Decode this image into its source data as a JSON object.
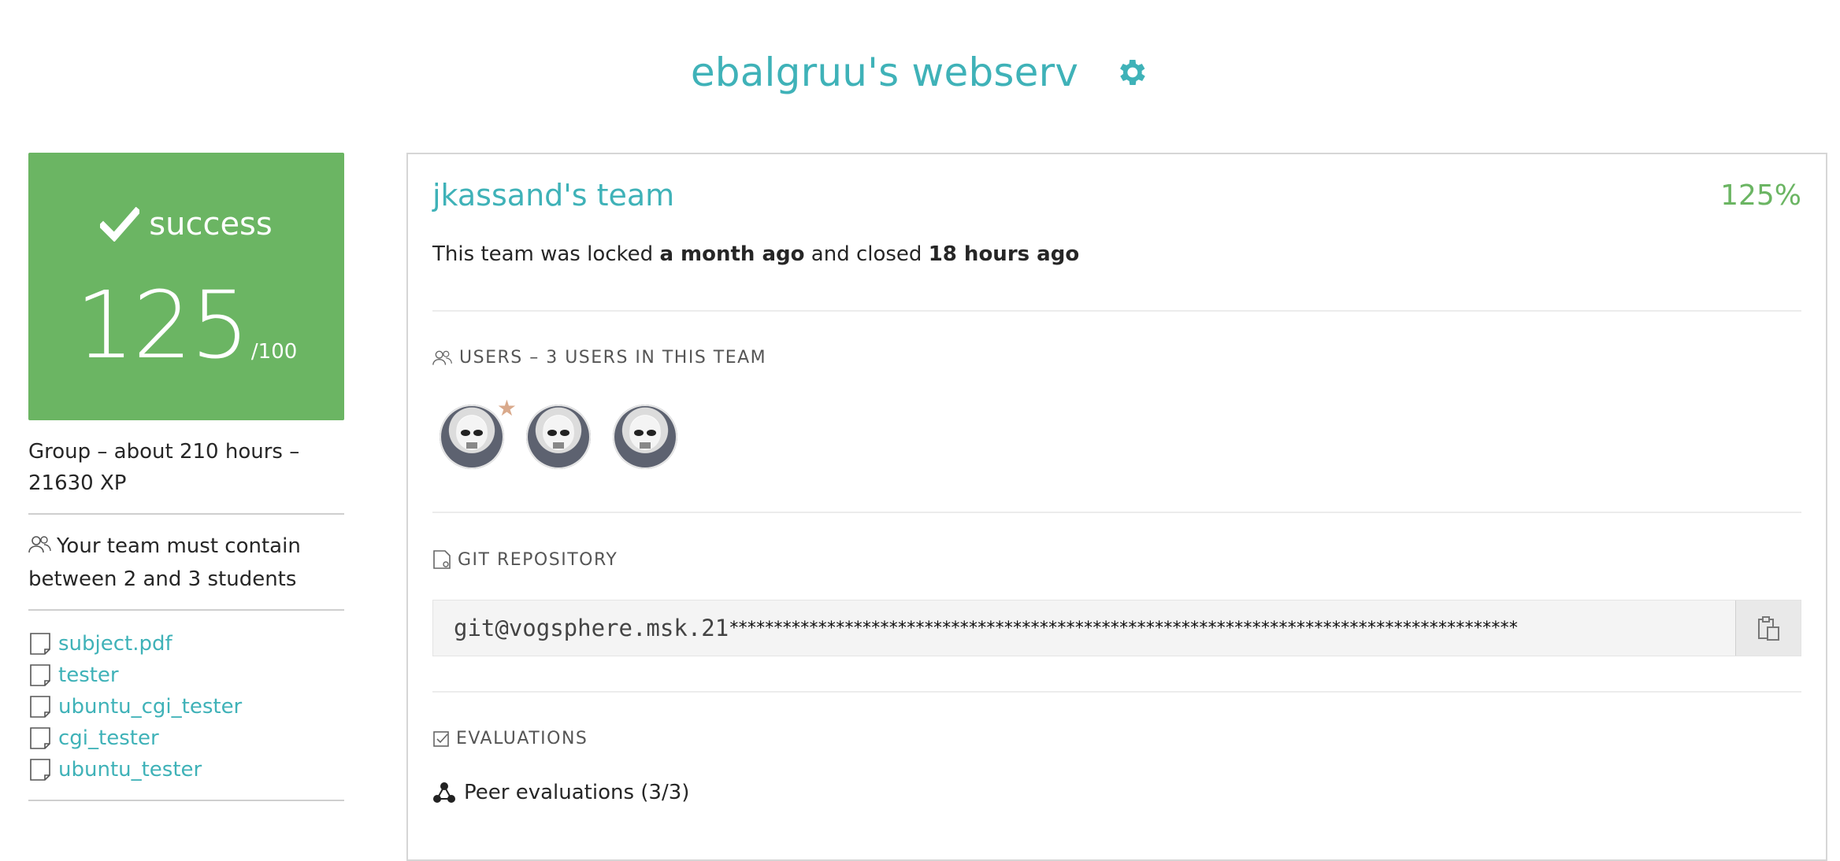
{
  "header": {
    "title": "ebalgruu's webserv",
    "settings_icon": "gear-icon"
  },
  "sidebar": {
    "status": "success",
    "score": "125",
    "score_max": "/100",
    "meta": "Group – about 210 hours – 21630 XP",
    "team_size": "Your team must contain between 2 and 3 students",
    "files": [
      "subject.pdf",
      "tester",
      "ubuntu_cgi_tester",
      "cgi_tester",
      "ubuntu_tester"
    ]
  },
  "team": {
    "name": "jkassand's team",
    "percent": "125%",
    "lock_prefix": "This team was locked ",
    "lock_when": "a month ago",
    "lock_mid": " and closed ",
    "closed_when": "18 hours ago",
    "users_title": "USERS – 3 USERS IN THIS TEAM",
    "git_title": "GIT REPOSITORY",
    "git_url": "git@vogsphere.msk.21",
    "git_mask": "*****************************************************************************************",
    "evaluations_title": "EVALUATIONS",
    "peer_evaluations": "Peer evaluations (3/3)"
  },
  "colors": {
    "accent": "#3fb2b8",
    "success": "#6bb563"
  }
}
